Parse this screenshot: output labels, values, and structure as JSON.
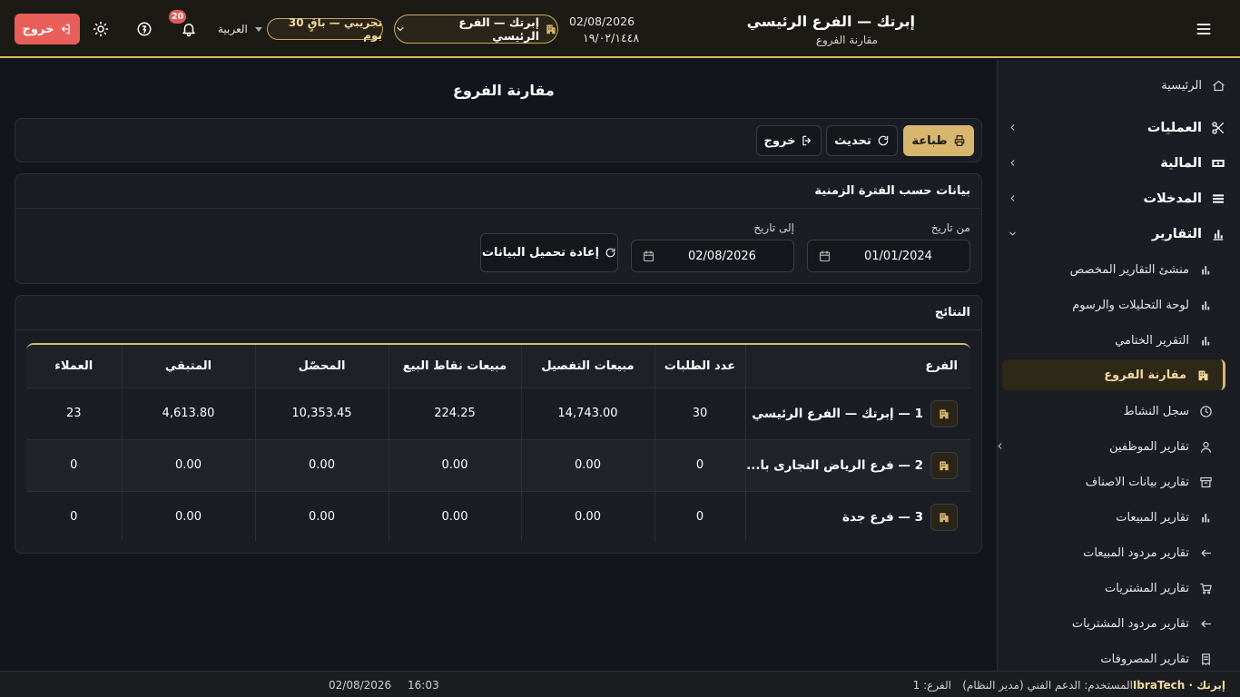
{
  "header": {
    "app_title": "إبرتك — الفرع الرئيسي",
    "app_subtitle": "مقارنة الفروع",
    "date_gregorian": "02/08/2026",
    "date_hijri": "١٩/٠٢/١٤٤٨",
    "branch_selector": "إبرتك — الفرع الرئيسي",
    "trial_badge": "تجريبي — باقٍ 30 يوم",
    "language": "العربية",
    "notification_count": "20",
    "logout_label": "خروج"
  },
  "sidebar": {
    "home": "الرئيسية",
    "operations": "العمليات",
    "finance": "المالية",
    "inputs": "المدخلات",
    "reports": "التقارير",
    "report_items": [
      "منشئ التقارير المخصص",
      "لوحة التحليلات والرسوم",
      "التقرير الختامي",
      "مقارنة الفروع",
      "سجل النشاط",
      "تقارير الموظفين",
      "تقارير بيانات الاصناف",
      "تقارير المبيعات",
      "تقارير مردود المبيعات",
      "تقارير المشتريات",
      "تقارير مردود المشتريات",
      "تقارير المصروفات"
    ]
  },
  "main": {
    "page_title": "مقارنة الفروع",
    "toolbar": {
      "print": "طباعة",
      "refresh": "تحديث",
      "exit": "خروج"
    },
    "period": {
      "title": "بيانات حسب الفترة الزمنية",
      "from_label": "من تاريخ",
      "from_value": "01/01/2024",
      "to_label": "إلى تاريخ",
      "to_value": "02/08/2026",
      "reload": "إعادة تحميل البيانات"
    },
    "results": {
      "title": "النتائج",
      "headers": [
        "الفرع",
        "عدد الطلبات",
        "مبيعات التفصيل",
        "مبيعات نقاط البيع",
        "المحصّل",
        "المتبقي",
        "العملاء"
      ],
      "rows": [
        [
          "1 — إبرتك — الفرع الرئيسي",
          "30",
          "14,743.00",
          "224.25",
          "10,353.45",
          "4,613.80",
          "23"
        ],
        [
          "2 — فرع الرياض التجارى با...",
          "0",
          "0.00",
          "0.00",
          "0.00",
          "0.00",
          "0"
        ],
        [
          "3 — فرع جدة",
          "0",
          "0.00",
          "0.00",
          "0.00",
          "0.00",
          "0"
        ]
      ]
    }
  },
  "statusbar": {
    "brand": "إبرتك · IbraTech",
    "user": "المستخدم: الدعم الفني (مدير النظام)",
    "branch": "الفرع: 1",
    "time": "16:03",
    "date": "02/08/2026"
  },
  "colors": {
    "accent": "#d8b66e",
    "danger": "#e85f5a",
    "background": "#13151c",
    "panel": "#1b1d24"
  }
}
